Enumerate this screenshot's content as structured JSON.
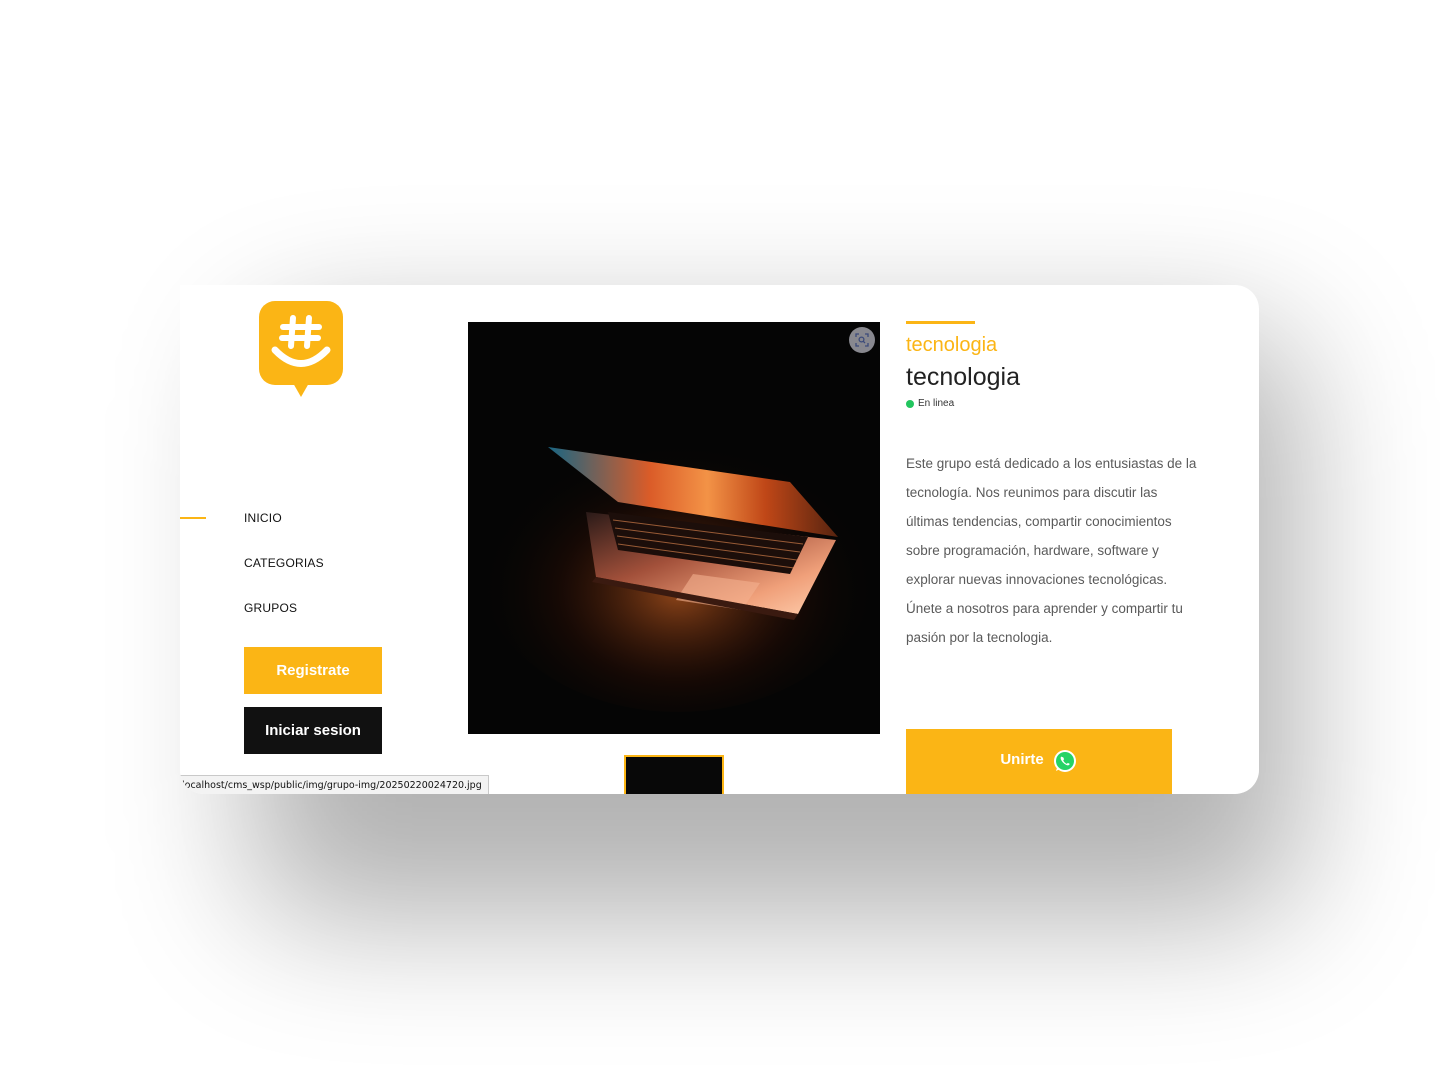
{
  "brand": {
    "accent": "#fbb515",
    "dark": "#111111",
    "logo_icon": "hashtag-smile-chat-icon"
  },
  "nav": {
    "items": [
      {
        "label": "INICIO",
        "active": true
      },
      {
        "label": "CATEGORIAS",
        "active": false
      },
      {
        "label": "GRUPOS",
        "active": false
      }
    ]
  },
  "auth": {
    "register_label": "Registrate",
    "login_label": "Iniciar sesion"
  },
  "status_bar": {
    "url": "localhost/cms_wsp/public/img/grupo-img/20250220024720.jpg"
  },
  "gallery": {
    "zoom_icon": "zoom-icon",
    "main_image": "laptop-photo"
  },
  "group": {
    "category": "tecnologia",
    "title": "tecnologia",
    "status": "En linea",
    "status_color": "#22c55e",
    "description": "Este grupo está dedicado a los entusiastas de la tecnología. Nos reunimos para discutir las últimas tendencias, compartir conocimientos sobre programación, hardware, software y explorar nuevas innovaciones tecnológicas. Únete a nosotros para aprender y compartir tu pasión por la tecnologia.",
    "join_label": "Unirte",
    "join_icon": "whatsapp-icon"
  }
}
